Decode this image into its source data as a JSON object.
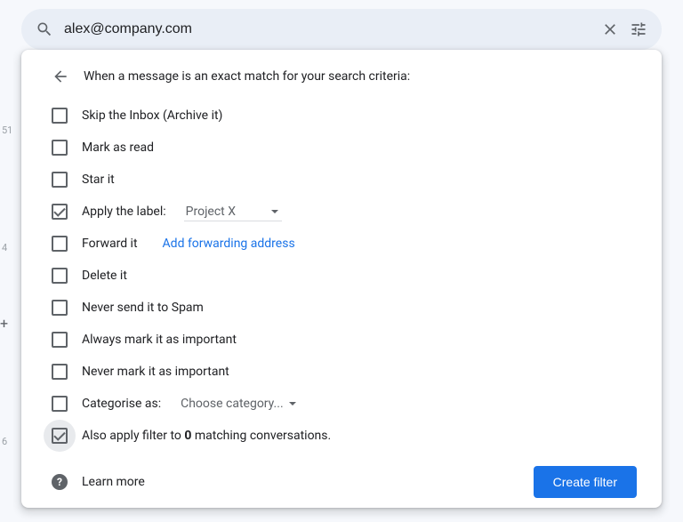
{
  "search": {
    "value": "alex@company.com"
  },
  "gutter": {
    "n1": "51",
    "n2": "4",
    "n3": "6"
  },
  "panel": {
    "header": "When a message is an exact match for your search criteria:",
    "options": {
      "skip_inbox": "Skip the Inbox (Archive it)",
      "mark_read": "Mark as read",
      "star": "Star it",
      "apply_label": "Apply the label:",
      "label_value": "Project X",
      "forward": "Forward it",
      "forward_link": "Add forwarding address",
      "delete": "Delete it",
      "never_spam": "Never send it to Spam",
      "always_important": "Always mark it as important",
      "never_important": "Never mark it as important",
      "categorise": "Categorise as:",
      "categorise_value": "Choose category...",
      "also_apply_pre": "Also apply filter to ",
      "also_apply_count": "0",
      "also_apply_post": " matching conversations."
    },
    "footer": {
      "learn_more": "Learn more",
      "create": "Create filter"
    }
  }
}
